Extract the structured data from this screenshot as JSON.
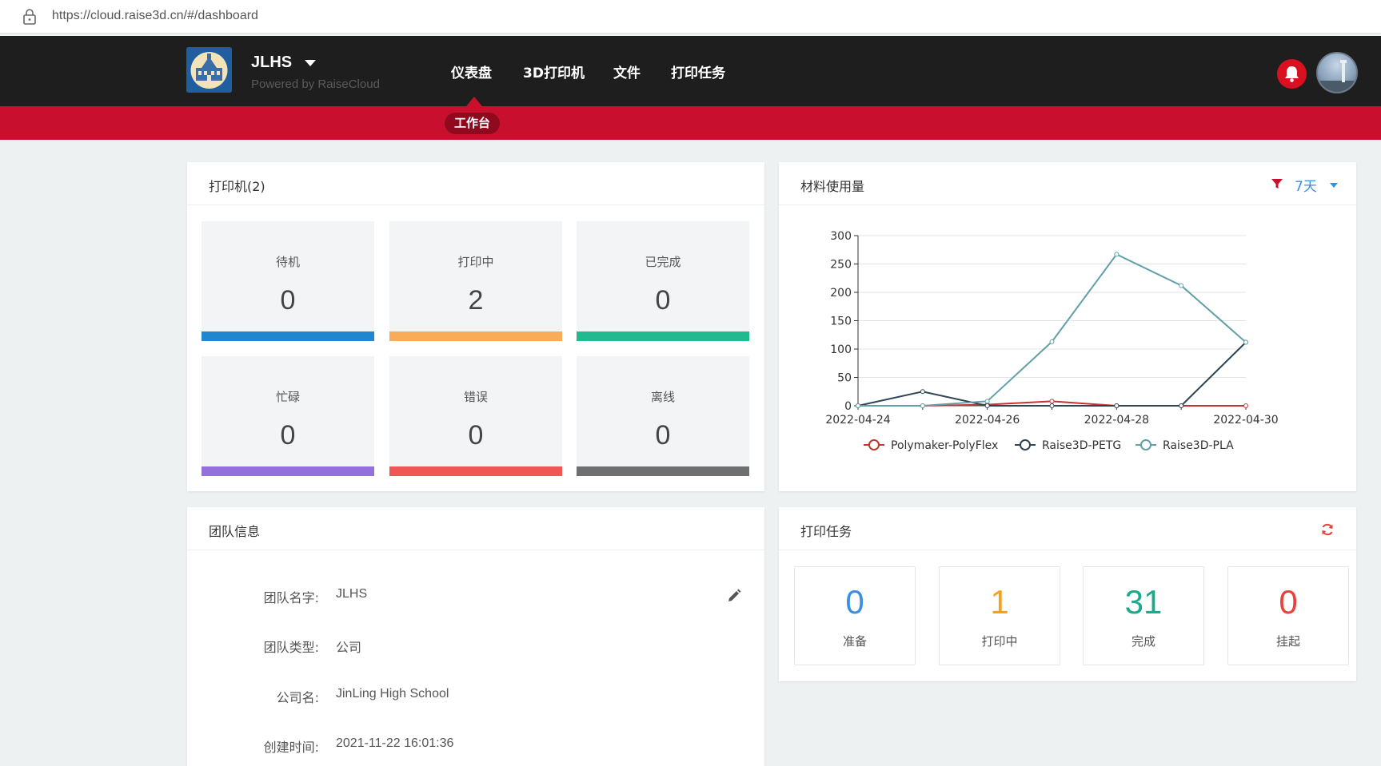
{
  "browser": {
    "url": "https://cloud.raise3d.cn/#/dashboard"
  },
  "header": {
    "team_name": "JLHS",
    "powered_by": "Powered by RaiseCloud",
    "menu": [
      {
        "label": "仪表盘",
        "active": true
      },
      {
        "label": "3D打印机",
        "active": false
      },
      {
        "label": "文件",
        "active": false
      },
      {
        "label": "打印任务",
        "active": false
      }
    ],
    "sub_menu_active": "工作台"
  },
  "printers": {
    "title": "打印机(2)",
    "statuses": [
      {
        "label": "待机",
        "count": "0",
        "color": "#2185d0"
      },
      {
        "label": "打印中",
        "count": "2",
        "color": "#f8ac59"
      },
      {
        "label": "已完成",
        "count": "0",
        "color": "#21ba8f"
      },
      {
        "label": "忙碌",
        "count": "0",
        "color": "#9370db"
      },
      {
        "label": "错误",
        "count": "0",
        "color": "#f05656"
      },
      {
        "label": "离线",
        "count": "0",
        "color": "#6f6f6f"
      }
    ]
  },
  "material": {
    "title": "材料使用量",
    "range_label": "7天",
    "chart_data": {
      "type": "line",
      "x": [
        "2022-04-24",
        "2022-04-25",
        "2022-04-26",
        "2022-04-27",
        "2022-04-28",
        "2022-04-29",
        "2022-04-30"
      ],
      "x_tick_labels": [
        "2022-04-24",
        "2022-04-26",
        "2022-04-28",
        "2022-04-30"
      ],
      "ylim": [
        0,
        300
      ],
      "y_ticks": [
        0,
        50,
        100,
        150,
        200,
        250,
        300
      ],
      "grid": true,
      "legend_position": "bottom",
      "series": [
        {
          "name": "Polymaker-PolyFlex",
          "color": "#c23531",
          "values": [
            0,
            0,
            2,
            8,
            0,
            0,
            0
          ]
        },
        {
          "name": "Raise3D-PETG",
          "color": "#2f4554",
          "values": [
            0,
            25,
            0,
            0,
            0,
            0,
            112
          ]
        },
        {
          "name": "Raise3D-PLA",
          "color": "#61a0a8",
          "values": [
            0,
            0,
            8,
            113,
            267,
            212,
            112
          ]
        }
      ]
    }
  },
  "team": {
    "title": "团队信息",
    "rows": [
      {
        "label": "团队名字:",
        "value": "JLHS"
      },
      {
        "label": "团队类型:",
        "value": "公司"
      },
      {
        "label": "公司名:",
        "value": "JinLing High School"
      },
      {
        "label": "创建时间:",
        "value": "2021-11-22 16:01:36"
      }
    ]
  },
  "tasks": {
    "title": "打印任务",
    "items": [
      {
        "label": "准备",
        "count": "0",
        "color": "#3a8ee6"
      },
      {
        "label": "打印中",
        "count": "1",
        "color": "#f7a11a"
      },
      {
        "label": "完成",
        "count": "31",
        "color": "#1aab8a"
      },
      {
        "label": "挂起",
        "count": "0",
        "color": "#e8413c"
      }
    ]
  }
}
